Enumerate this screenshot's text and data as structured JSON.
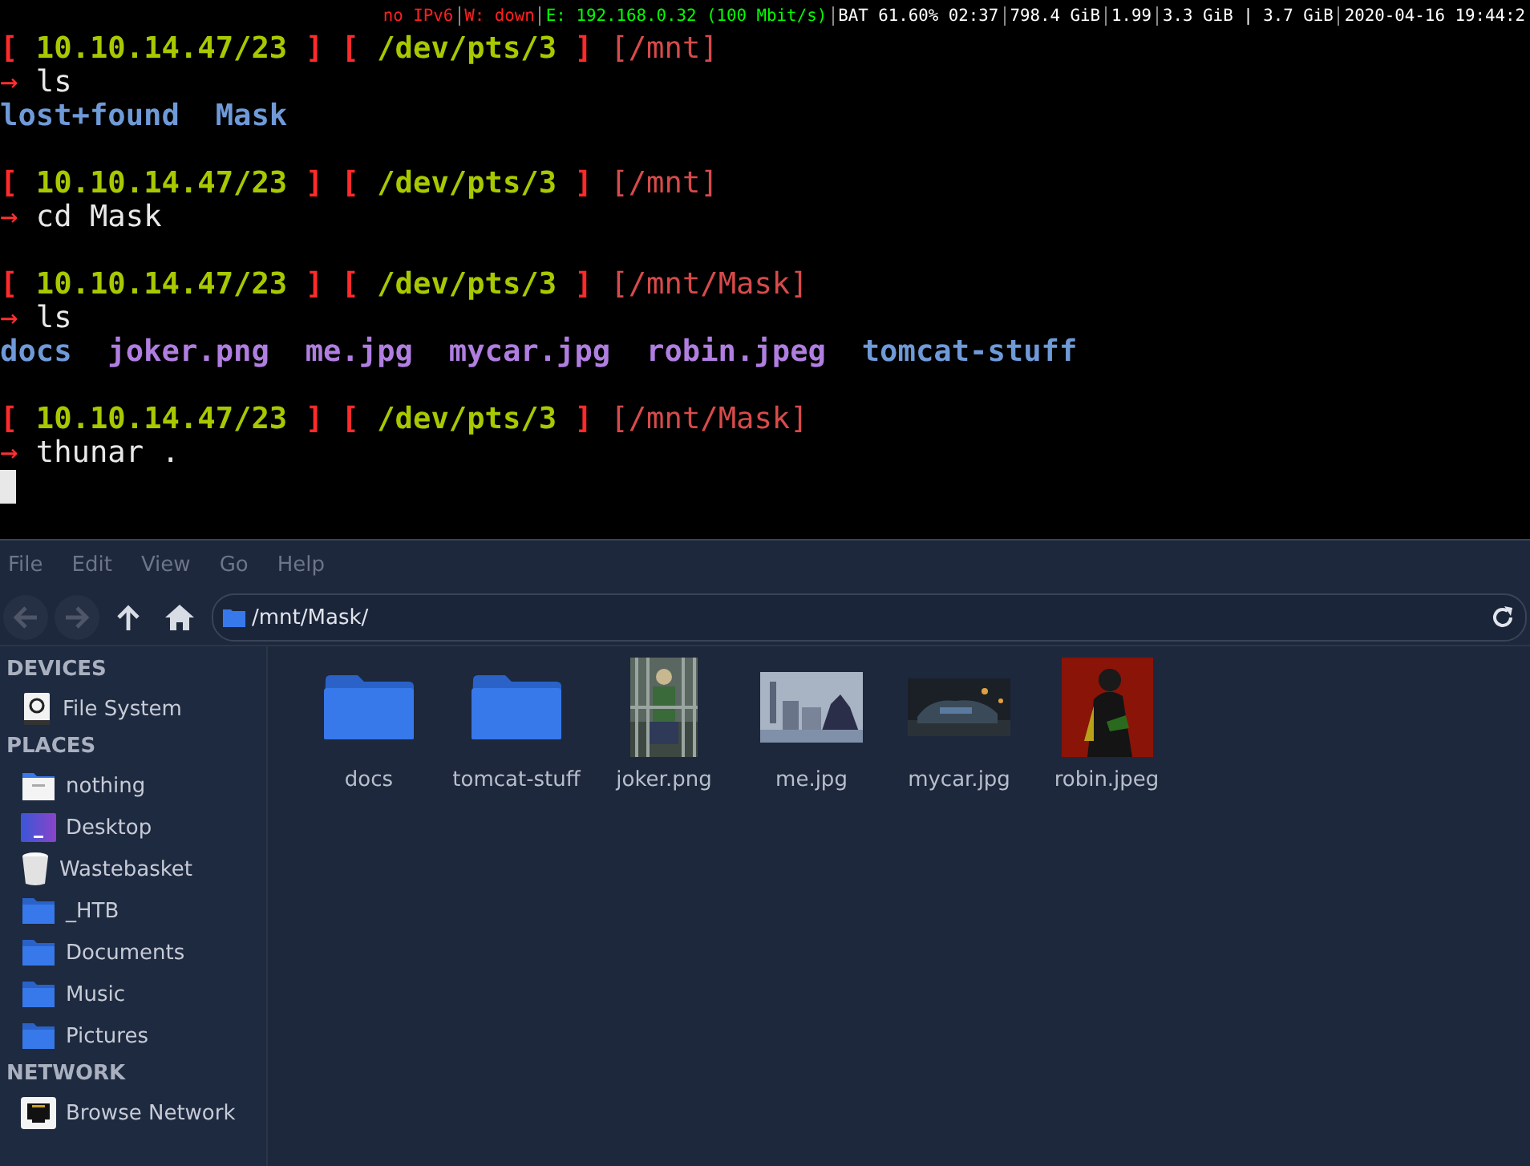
{
  "status_bar": [
    {
      "text": "no IPv6",
      "color": "#ff2020"
    },
    {
      "text": "W: down",
      "color": "#ff2020"
    },
    {
      "text": "E: 192.168.0.32 (100 Mbit/s)",
      "color": "#00ff00"
    },
    {
      "text": "BAT 61.60% 02:37",
      "color": "#ffffff"
    },
    {
      "text": "798.4 GiB",
      "color": "#ffffff"
    },
    {
      "text": "1.99",
      "color": "#ffffff"
    },
    {
      "text": "3.3 GiB | 3.7 GiB",
      "color": "#ffffff"
    },
    {
      "text": "2020-04-16 19:44:2",
      "color": "#ffffff"
    }
  ],
  "terminal": {
    "lines": [
      {
        "kind": "prompt",
        "segments": [
          {
            "text": "[",
            "color": "#ff2a2a"
          },
          {
            "text": " 10.10.14.47/23 ",
            "color": "#a8c800"
          },
          {
            "text": "] ",
            "color": "#ff2a2a"
          },
          {
            "text": "[",
            "color": "#ff2a2a"
          },
          {
            "text": " /dev/pts/3 ",
            "color": "#a8c800"
          },
          {
            "text": "]",
            "color": "#ff2a2a"
          },
          {
            "text": " [/mnt]",
            "color": "#d84a4a"
          }
        ]
      },
      {
        "kind": "command",
        "arrow": "→",
        "text": "ls"
      },
      {
        "kind": "listing",
        "items": [
          {
            "name": "lost+found",
            "kind": "directory"
          },
          {
            "name": "Mask",
            "kind": "directory"
          }
        ]
      },
      {
        "kind": "prompt",
        "segments": [
          {
            "text": "[",
            "color": "#ff2a2a"
          },
          {
            "text": " 10.10.14.47/23 ",
            "color": "#a8c800"
          },
          {
            "text": "] ",
            "color": "#ff2a2a"
          },
          {
            "text": "[",
            "color": "#ff2a2a"
          },
          {
            "text": " /dev/pts/3 ",
            "color": "#a8c800"
          },
          {
            "text": "]",
            "color": "#ff2a2a"
          },
          {
            "text": " [/mnt]",
            "color": "#d84a4a"
          }
        ]
      },
      {
        "kind": "command",
        "arrow": "→",
        "text": "cd Mask"
      },
      {
        "kind": "prompt",
        "segments": [
          {
            "text": "[",
            "color": "#ff2a2a"
          },
          {
            "text": " 10.10.14.47/23 ",
            "color": "#a8c800"
          },
          {
            "text": "] ",
            "color": "#ff2a2a"
          },
          {
            "text": "[",
            "color": "#ff2a2a"
          },
          {
            "text": " /dev/pts/3 ",
            "color": "#a8c800"
          },
          {
            "text": "]",
            "color": "#ff2a2a"
          },
          {
            "text": " [/mnt/Mask]",
            "color": "#d84a4a"
          }
        ]
      },
      {
        "kind": "command",
        "arrow": "→",
        "text": "ls"
      },
      {
        "kind": "listing",
        "items": [
          {
            "name": "docs",
            "kind": "directory"
          },
          {
            "name": "joker.png"
          },
          {
            "name": "me.jpg"
          },
          {
            "name": "mycar.jpg"
          },
          {
            "name": "robin.jpeg"
          },
          {
            "name": "tomcat-stuff",
            "kind": "directory"
          }
        ]
      },
      {
        "kind": "prompt",
        "segments": [
          {
            "text": "[",
            "color": "#ff2a2a"
          },
          {
            "text": " 10.10.14.47/23 ",
            "color": "#a8c800"
          },
          {
            "text": "] ",
            "color": "#ff2a2a"
          },
          {
            "text": "[",
            "color": "#ff2a2a"
          },
          {
            "text": " /dev/pts/3 ",
            "color": "#a8c800"
          },
          {
            "text": "]",
            "color": "#ff2a2a"
          },
          {
            "text": " [/mnt/Mask]",
            "color": "#d84a4a"
          }
        ]
      },
      {
        "kind": "command",
        "arrow": "→",
        "text": "thunar ."
      },
      {
        "kind": "cursor"
      }
    ]
  },
  "file_manager": {
    "menu": [
      {
        "label": "File"
      },
      {
        "label": "Edit"
      },
      {
        "label": "View"
      },
      {
        "label": "Go"
      },
      {
        "label": "Help"
      }
    ],
    "toolbar": [
      {
        "kind": "back",
        "disabled": true
      },
      {
        "kind": "forward",
        "disabled": true
      },
      {
        "kind": "up",
        "disabled": false
      },
      {
        "kind": "home",
        "disabled": false
      }
    ],
    "location": "/mnt/Mask/",
    "sidebar": [
      {
        "title": "DEVICES",
        "items": [
          {
            "label": "File System",
            "kind": "drive"
          }
        ]
      },
      {
        "title": "PLACES",
        "items": [
          {
            "label": "nothing",
            "kind": "home"
          },
          {
            "label": "Desktop",
            "kind": "desktop"
          },
          {
            "label": "Wastebasket",
            "kind": "trash"
          },
          {
            "label": "_HTB",
            "kind": "folder"
          },
          {
            "label": "Documents",
            "kind": "folder"
          },
          {
            "label": "Music",
            "kind": "folder"
          },
          {
            "label": "Pictures",
            "kind": "folder"
          }
        ]
      },
      {
        "title": "NETWORK",
        "items": [
          {
            "label": "Browse Network",
            "kind": "network"
          }
        ]
      }
    ],
    "files": [
      {
        "name": "docs",
        "kind": "folder"
      },
      {
        "name": "tomcat-stuff",
        "kind": "folder"
      },
      {
        "name": "joker.png",
        "kind": "portrait"
      },
      {
        "name": "me.jpg",
        "kind": "wide"
      },
      {
        "name": "mycar.jpg",
        "kind": "night"
      },
      {
        "name": "robin.jpeg",
        "kind": "square"
      }
    ]
  }
}
